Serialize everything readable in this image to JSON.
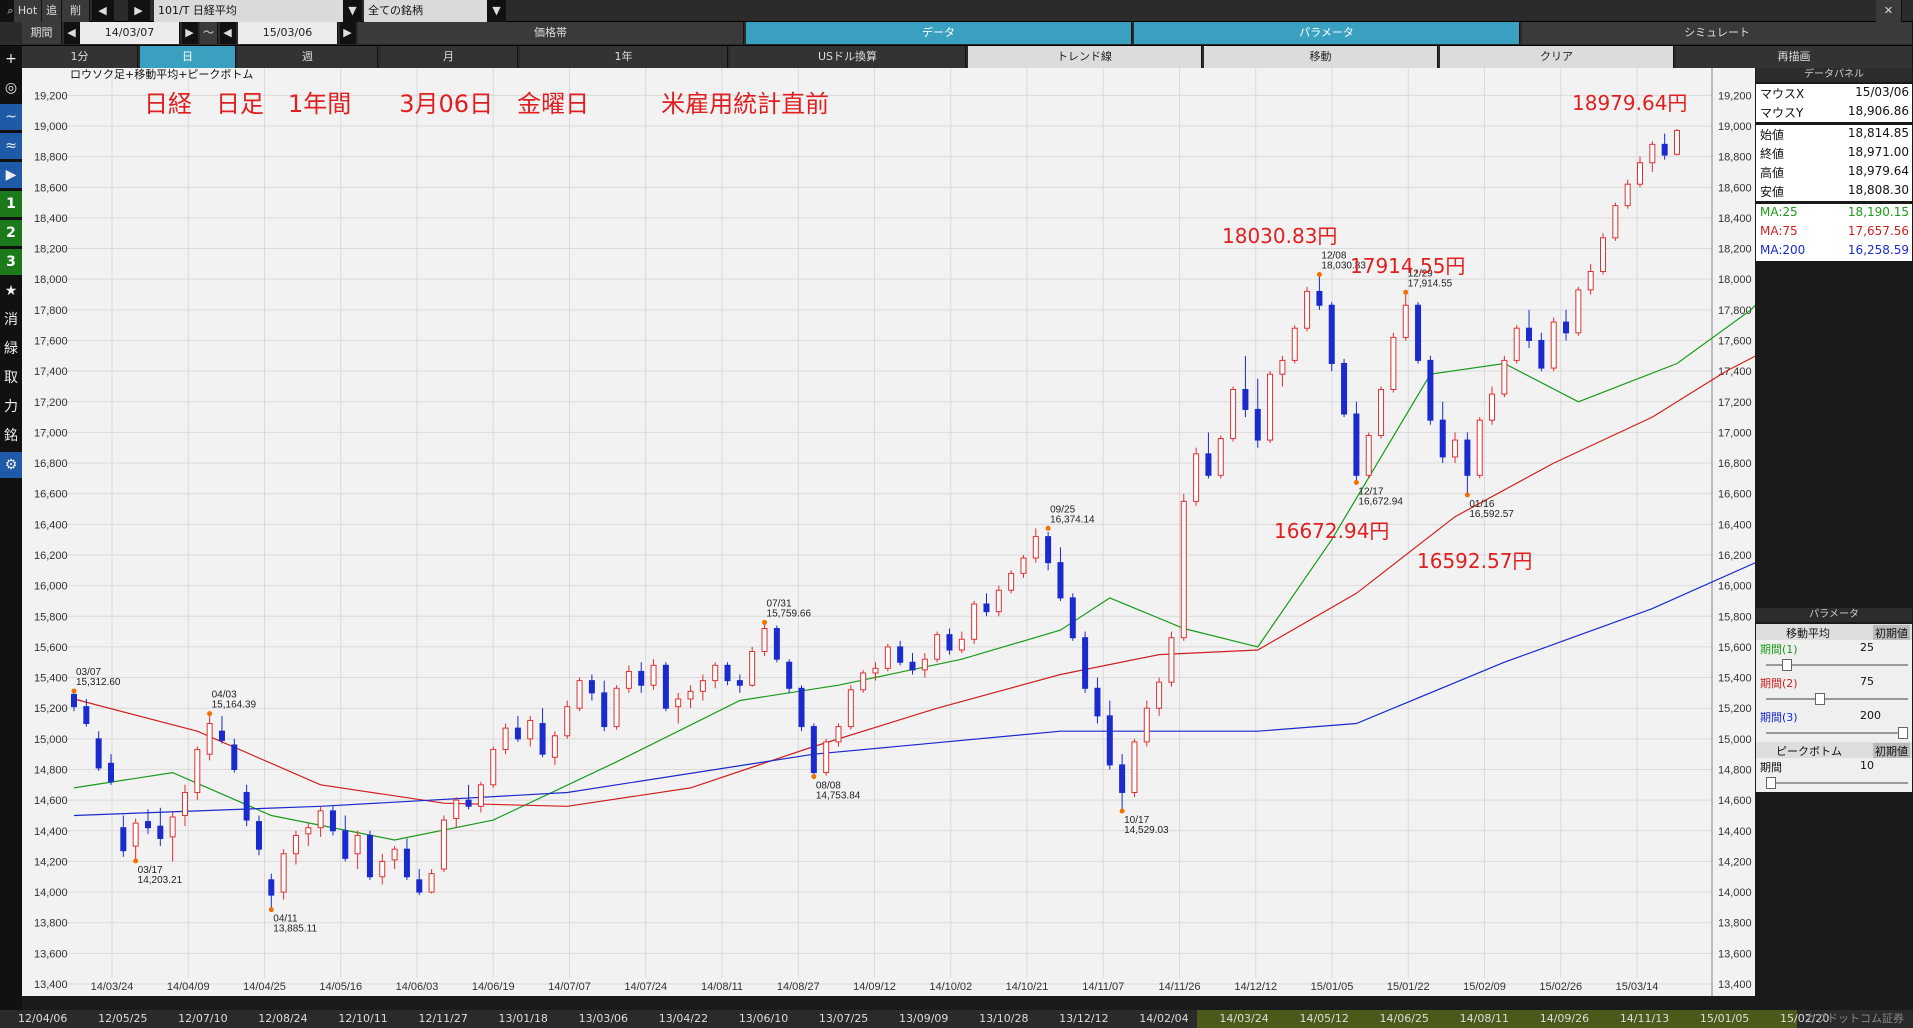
{
  "toolbar": {
    "hot": "Hot",
    "add": "追",
    "del": "削",
    "symbol": "101/T 日経平均",
    "universe": "全ての銘柄",
    "period_label": "期間",
    "date_from": "14/03/07",
    "tilde": "～",
    "date_to": "15/03/06",
    "btn_price_band": "価格帯",
    "btn_data": "データ",
    "btn_parameter": "パラメータ",
    "btn_simulate": "シミュレート"
  },
  "tabs": [
    {
      "label": "1分",
      "selected": false
    },
    {
      "label": "日",
      "selected": true
    },
    {
      "label": "週",
      "selected": false
    },
    {
      "label": "月",
      "selected": false
    },
    {
      "label": "1年",
      "selected": false
    },
    {
      "label": "USドル換算",
      "selected": false
    },
    {
      "label": "トレンド線",
      "selected": false
    },
    {
      "label": "移動",
      "selected": false
    },
    {
      "label": "クリア",
      "selected": false
    },
    {
      "label": "再描画",
      "selected": false
    }
  ],
  "leftbar": {
    "items": [
      "+",
      "◎",
      "~",
      "≈",
      "▶",
      "1",
      "2",
      "3",
      "★",
      "消",
      "緑",
      "取",
      "力",
      "銘",
      "⚙"
    ]
  },
  "chart_data": {
    "type": "candlestick",
    "subtitle": "ロウソク足+移動平均+ピークボトム",
    "title": "日経　日足　1年間　　3月06日　金曜日　　　米雇用統計直前",
    "ylim": [
      13400,
      19300
    ],
    "yticks": [
      13400,
      13600,
      13800,
      14000,
      14200,
      14400,
      14600,
      14800,
      15000,
      15200,
      15400,
      15600,
      15800,
      16000,
      16200,
      16400,
      16600,
      16800,
      17000,
      17200,
      17400,
      17600,
      17800,
      18000,
      18200,
      18400,
      18600,
      18800,
      19000,
      19200
    ],
    "xticks": [
      "14/03/24",
      "14/04/09",
      "14/04/25",
      "14/05/16",
      "14/06/03",
      "14/06/19",
      "14/07/07",
      "14/07/24",
      "14/08/11",
      "14/08/27",
      "14/09/12",
      "14/10/02",
      "14/10/21",
      "14/11/07",
      "14/11/26",
      "14/12/12",
      "15/01/05",
      "15/01/22",
      "15/02/09",
      "15/02/26",
      "15/03/14"
    ],
    "annotations_red": [
      {
        "text": "18979.64円"
      },
      {
        "text": "18030.83円"
      },
      {
        "text": "17914.55円"
      },
      {
        "text": "16672.94円"
      },
      {
        "text": "16592.57円"
      }
    ],
    "peaks": [
      {
        "date": "03/07",
        "value": "15,312.60",
        "y": 15312.6
      },
      {
        "date": "04/03",
        "value": "15,164.39",
        "y": 15164.39
      },
      {
        "date": "03/17",
        "value": "14,203.21",
        "y": 14203.21
      },
      {
        "date": "04/11",
        "value": "13,885.11",
        "y": 13885.11
      },
      {
        "date": "07/31",
        "value": "15,759.66",
        "y": 15759.66
      },
      {
        "date": "08/08",
        "value": "14,753.84",
        "y": 14753.84
      },
      {
        "date": "09/25",
        "value": "16,374.14",
        "y": 16374.14
      },
      {
        "date": "10/17",
        "value": "14,529.03",
        "y": 14529.03
      },
      {
        "date": "12/08",
        "value": "18,030.83",
        "y": 18030.83
      },
      {
        "date": "12/29",
        "value": "17,914.55",
        "y": 17914.55
      },
      {
        "date": "12/17",
        "value": "16,672.94",
        "y": 16672.94
      },
      {
        "date": "01/16",
        "value": "16,592.57",
        "y": 16592.57
      }
    ],
    "candles": [
      [
        15290,
        15312,
        15180,
        15210
      ],
      [
        15210,
        15260,
        15080,
        15100
      ],
      [
        15000,
        15050,
        14790,
        14810
      ],
      [
        14840,
        14900,
        14700,
        14720
      ],
      [
        14420,
        14500,
        14230,
        14270
      ],
      [
        14300,
        14480,
        14203,
        14450
      ],
      [
        14460,
        14540,
        14380,
        14420
      ],
      [
        14430,
        14550,
        14300,
        14350
      ],
      [
        14360,
        14520,
        14200,
        14490
      ],
      [
        14500,
        14700,
        14430,
        14650
      ],
      [
        14650,
        14950,
        14600,
        14930
      ],
      [
        14900,
        15164,
        14860,
        15100
      ],
      [
        15050,
        15150,
        14970,
        14990
      ],
      [
        14960,
        15000,
        14780,
        14800
      ],
      [
        14650,
        14700,
        14430,
        14470
      ],
      [
        14460,
        14500,
        14240,
        14280
      ],
      [
        14080,
        14120,
        13885,
        13980
      ],
      [
        14000,
        14280,
        13950,
        14250
      ],
      [
        14250,
        14400,
        14180,
        14370
      ],
      [
        14380,
        14450,
        14300,
        14420
      ],
      [
        14420,
        14560,
        14360,
        14530
      ],
      [
        14530,
        14560,
        14370,
        14400
      ],
      [
        14400,
        14500,
        14200,
        14220
      ],
      [
        14250,
        14400,
        14150,
        14370
      ],
      [
        14370,
        14400,
        14080,
        14100
      ],
      [
        14100,
        14250,
        14050,
        14200
      ],
      [
        14210,
        14300,
        14150,
        14280
      ],
      [
        14280,
        14350,
        14080,
        14100
      ],
      [
        14080,
        14150,
        13980,
        14000
      ],
      [
        14000,
        14150,
        13990,
        14120
      ],
      [
        14150,
        14500,
        14130,
        14470
      ],
      [
        14480,
        14620,
        14420,
        14600
      ],
      [
        14600,
        14700,
        14540,
        14560
      ],
      [
        14560,
        14720,
        14520,
        14700
      ],
      [
        14700,
        14950,
        14680,
        14930
      ],
      [
        14930,
        15100,
        14900,
        15070
      ],
      [
        15070,
        15150,
        14980,
        15000
      ],
      [
        15000,
        15150,
        14950,
        15120
      ],
      [
        15100,
        15200,
        14880,
        14900
      ],
      [
        14880,
        15050,
        14830,
        15020
      ],
      [
        15020,
        15250,
        15000,
        15210
      ],
      [
        15200,
        15400,
        15180,
        15380
      ],
      [
        15380,
        15420,
        15250,
        15300
      ],
      [
        15300,
        15380,
        15050,
        15080
      ],
      [
        15080,
        15350,
        15060,
        15330
      ],
      [
        15330,
        15480,
        15300,
        15440
      ],
      [
        15440,
        15500,
        15300,
        15350
      ],
      [
        15350,
        15520,
        15320,
        15480
      ],
      [
        15480,
        15500,
        15180,
        15200
      ],
      [
        15210,
        15300,
        15100,
        15260
      ],
      [
        15260,
        15350,
        15200,
        15310
      ],
      [
        15310,
        15420,
        15250,
        15380
      ],
      [
        15380,
        15500,
        15330,
        15480
      ],
      [
        15480,
        15500,
        15350,
        15380
      ],
      [
        15380,
        15420,
        15300,
        15350
      ],
      [
        15350,
        15600,
        15340,
        15570
      ],
      [
        15570,
        15760,
        15540,
        15720
      ],
      [
        15720,
        15740,
        15500,
        15520
      ],
      [
        15500,
        15520,
        15300,
        15330
      ],
      [
        15330,
        15350,
        15050,
        15080
      ],
      [
        15080,
        15100,
        14754,
        14780
      ],
      [
        14780,
        15000,
        14760,
        14980
      ],
      [
        14980,
        15100,
        14950,
        15080
      ],
      [
        15080,
        15350,
        15060,
        15320
      ],
      [
        15320,
        15450,
        15300,
        15430
      ],
      [
        15430,
        15500,
        15380,
        15460
      ],
      [
        15460,
        15620,
        15440,
        15600
      ],
      [
        15600,
        15640,
        15480,
        15500
      ],
      [
        15500,
        15560,
        15420,
        15450
      ],
      [
        15450,
        15560,
        15400,
        15520
      ],
      [
        15520,
        15700,
        15500,
        15680
      ],
      [
        15680,
        15720,
        15550,
        15580
      ],
      [
        15580,
        15700,
        15560,
        15650
      ],
      [
        15650,
        15900,
        15620,
        15880
      ],
      [
        15880,
        15950,
        15800,
        15830
      ],
      [
        15830,
        16000,
        15800,
        15970
      ],
      [
        15970,
        16100,
        15950,
        16080
      ],
      [
        16080,
        16200,
        16050,
        16180
      ],
      [
        16180,
        16374,
        16150,
        16320
      ],
      [
        16320,
        16350,
        16100,
        16150
      ],
      [
        16150,
        16250,
        15900,
        15920
      ],
      [
        15920,
        15950,
        15640,
        15660
      ],
      [
        15660,
        15700,
        15300,
        15330
      ],
      [
        15330,
        15400,
        15100,
        15150
      ],
      [
        15150,
        15250,
        14800,
        14830
      ],
      [
        14830,
        14900,
        14529,
        14650
      ],
      [
        14650,
        15000,
        14620,
        14980
      ],
      [
        14980,
        15250,
        14950,
        15200
      ],
      [
        15200,
        15400,
        15150,
        15370
      ],
      [
        15370,
        15700,
        15340,
        15660
      ],
      [
        15660,
        16600,
        15640,
        16550
      ],
      [
        16550,
        16900,
        16520,
        16860
      ],
      [
        16860,
        17000,
        16700,
        16720
      ],
      [
        16720,
        16980,
        16700,
        16960
      ],
      [
        16960,
        17300,
        16940,
        17280
      ],
      [
        17280,
        17500,
        17100,
        17150
      ],
      [
        17150,
        17350,
        16900,
        16950
      ],
      [
        16950,
        17400,
        16930,
        17380
      ],
      [
        17380,
        17500,
        17300,
        17470
      ],
      [
        17470,
        17700,
        17450,
        17680
      ],
      [
        17680,
        17950,
        17660,
        17920
      ],
      [
        17920,
        18031,
        17800,
        17830
      ],
      [
        17830,
        17850,
        17400,
        17450
      ],
      [
        17450,
        17480,
        17100,
        17120
      ],
      [
        17120,
        17200,
        16673,
        16720
      ],
      [
        16720,
        17000,
        16700,
        16980
      ],
      [
        16980,
        17300,
        16960,
        17280
      ],
      [
        17280,
        17650,
        17260,
        17620
      ],
      [
        17620,
        17915,
        17600,
        17830
      ],
      [
        17830,
        17850,
        17450,
        17470
      ],
      [
        17470,
        17500,
        17050,
        17080
      ],
      [
        17080,
        17200,
        16800,
        16840
      ],
      [
        16840,
        17000,
        16800,
        16950
      ],
      [
        16950,
        17000,
        16593,
        16720
      ],
      [
        16720,
        17100,
        16700,
        17080
      ],
      [
        17080,
        17300,
        17050,
        17250
      ],
      [
        17250,
        17500,
        17230,
        17470
      ],
      [
        17470,
        17700,
        17450,
        17680
      ],
      [
        17680,
        17800,
        17550,
        17600
      ],
      [
        17600,
        17650,
        17400,
        17420
      ],
      [
        17420,
        17750,
        17400,
        17720
      ],
      [
        17720,
        17800,
        17600,
        17650
      ],
      [
        17650,
        17950,
        17630,
        17930
      ],
      [
        17930,
        18100,
        17900,
        18050
      ],
      [
        18050,
        18300,
        18030,
        18270
      ],
      [
        18270,
        18500,
        18250,
        18480
      ],
      [
        18480,
        18650,
        18460,
        18620
      ],
      [
        18620,
        18800,
        18600,
        18760
      ],
      [
        18760,
        18900,
        18700,
        18880
      ],
      [
        18880,
        18950,
        18780,
        18810
      ],
      [
        18815,
        18980,
        18808,
        18971
      ]
    ],
    "ma": [
      {
        "name": "MA:25",
        "color": "#1a9a1a",
        "points": [
          [
            0,
            14680
          ],
          [
            8,
            14780
          ],
          [
            16,
            14500
          ],
          [
            26,
            14340
          ],
          [
            34,
            14470
          ],
          [
            44,
            14850
          ],
          [
            54,
            15250
          ],
          [
            62,
            15350
          ],
          [
            72,
            15520
          ],
          [
            80,
            15710
          ],
          [
            84,
            15920
          ],
          [
            90,
            15720
          ],
          [
            96,
            15600
          ],
          [
            102,
            16300
          ],
          [
            110,
            17380
          ],
          [
            116,
            17450
          ],
          [
            122,
            17200
          ],
          [
            130,
            17450
          ],
          [
            136,
            17800
          ],
          [
            140,
            18150
          ]
        ]
      },
      {
        "name": "MA:75",
        "color": "#d02020",
        "points": [
          [
            0,
            15260
          ],
          [
            10,
            15050
          ],
          [
            20,
            14700
          ],
          [
            30,
            14580
          ],
          [
            40,
            14560
          ],
          [
            50,
            14680
          ],
          [
            60,
            14950
          ],
          [
            70,
            15200
          ],
          [
            80,
            15420
          ],
          [
            88,
            15550
          ],
          [
            96,
            15580
          ],
          [
            104,
            15950
          ],
          [
            112,
            16450
          ],
          [
            120,
            16800
          ],
          [
            128,
            17100
          ],
          [
            134,
            17400
          ],
          [
            140,
            17650
          ]
        ]
      },
      {
        "name": "MA:200",
        "color": "#1a2acc",
        "points": [
          [
            0,
            14500
          ],
          [
            20,
            14560
          ],
          [
            40,
            14650
          ],
          [
            60,
            14900
          ],
          [
            80,
            15050
          ],
          [
            96,
            15050
          ],
          [
            104,
            15100
          ],
          [
            116,
            15500
          ],
          [
            128,
            15850
          ],
          [
            140,
            16280
          ]
        ]
      }
    ]
  },
  "data_panel": {
    "header": "データパネル",
    "rows": [
      {
        "k": "マウスX",
        "v": "15/03/06"
      },
      {
        "k": "マウスY",
        "v": "18,906.86"
      },
      {
        "k": "始値",
        "v": "18,814.85"
      },
      {
        "k": "終値",
        "v": "18,971.00"
      },
      {
        "k": "高値",
        "v": "18,979.64"
      },
      {
        "k": "安値",
        "v": "18,808.30"
      },
      {
        "k": "MA:25",
        "v": "18,190.15",
        "color": "#1a9a1a"
      },
      {
        "k": "MA:75",
        "v": "17,657.56",
        "color": "#d02020"
      },
      {
        "k": "MA:200",
        "v": "16,258.59",
        "color": "#1a2acc"
      }
    ]
  },
  "param_panel": {
    "header": "パラメータ",
    "ma_title": "移動平均",
    "ma_reset": "初期値",
    "ma_params": [
      {
        "label": "期間(1)",
        "value": "25",
        "color": "#1a9a1a",
        "level": 0.12
      },
      {
        "label": "期間(2)",
        "value": "75",
        "color": "#d02020",
        "level": 0.37
      },
      {
        "label": "期間(3)",
        "value": "200",
        "color": "#1a2acc",
        "level": 1.0
      }
    ],
    "pb_title": "ピークボトム",
    "pb_reset": "初期値",
    "pb_params": [
      {
        "label": "期間",
        "value": "10",
        "level": 0.0
      }
    ]
  },
  "timeline": [
    "12/04/06",
    "12/05/25",
    "12/07/10",
    "12/08/24",
    "12/10/11",
    "12/11/27",
    "13/01/18",
    "13/03/06",
    "13/04/22",
    "13/06/10",
    "13/07/25",
    "13/09/09",
    "13/10/28",
    "13/12/12",
    "14/02/04",
    "14/03/24",
    "14/05/12",
    "14/06/25",
    "14/08/11",
    "14/09/26",
    "14/11/13",
    "15/01/05",
    "15/02/20"
  ],
  "footer_brand": "カブドットコム証券"
}
